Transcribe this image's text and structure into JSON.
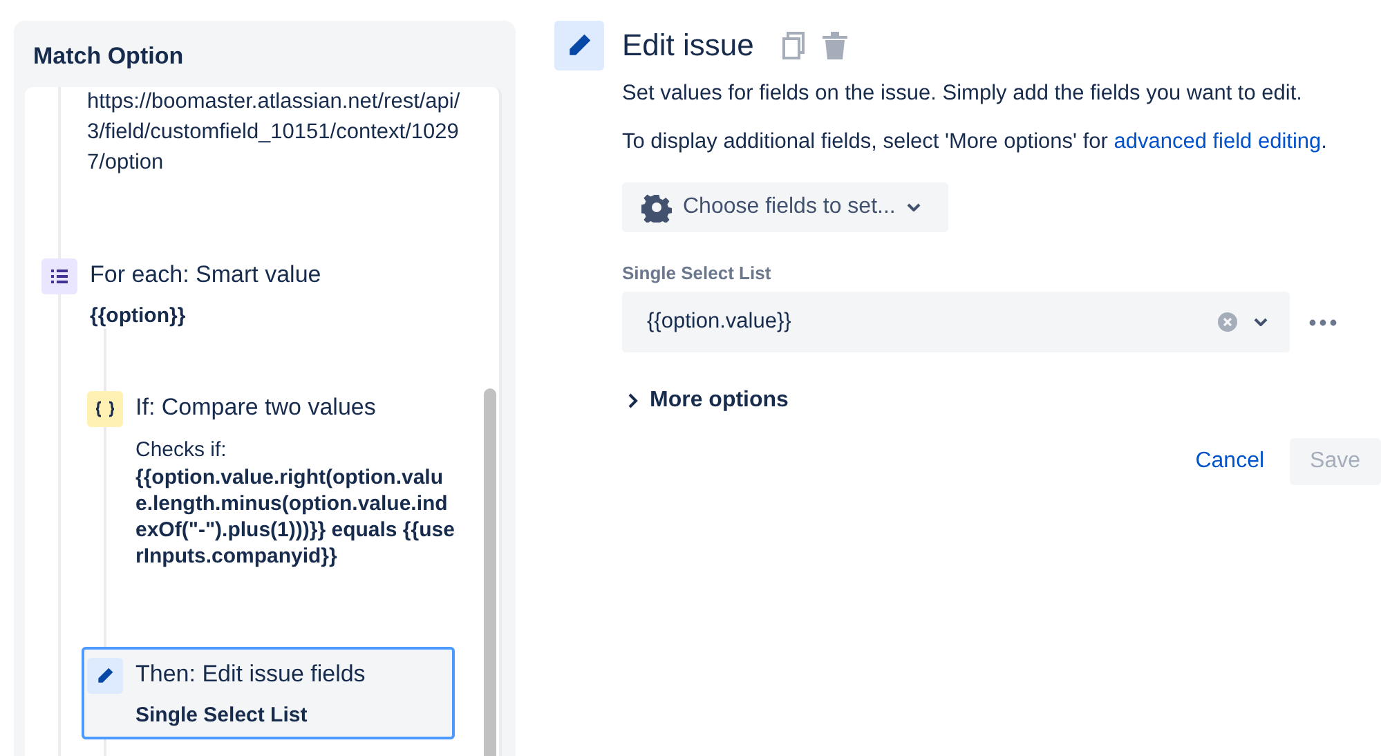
{
  "panel": {
    "title": "Match Option"
  },
  "steps": [
    {
      "kind": "text",
      "text": "https://boomaster.atlassian.net/rest/api/3/field/customfield_10151/context/10297/option"
    },
    {
      "kind": "branch",
      "selected": false,
      "title": "For each: Smart value",
      "detail": "{{option}}",
      "children": [
        {
          "kind": "condition",
          "selected": false,
          "title": "If: Compare two values",
          "lead": "Checks if:",
          "detail": "{{option.value.right(option.value.length.minus(option.value.indexOf(\"-\").plus(1)))}} equals {{userInputs.companyid}}"
        },
        {
          "kind": "action",
          "selected": true,
          "title": "Then: Edit issue fields",
          "detail": "Single Select List"
        }
      ]
    }
  ],
  "editor": {
    "title": "Edit issue",
    "description": "Set values for fields on the issue. Simply add the fields you want to edit.",
    "note": "To display additional fields, select 'More options' for ",
    "note_link": "advanced field editing",
    "note_end": ".",
    "choose_button": "Choose fields to set...",
    "field_label": "Single Select List",
    "field_value": "{{option.value}}",
    "more_options": {
      "label": "More options",
      "expanded": false
    },
    "cancel": "Cancel",
    "save": {
      "label": "Save",
      "disabled": true
    }
  }
}
